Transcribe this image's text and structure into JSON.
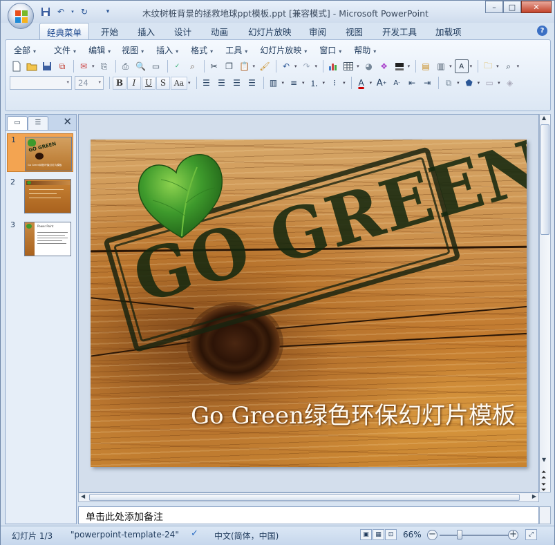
{
  "window": {
    "title": "木纹树桩背景的拯救地球ppt模板.ppt [兼容模式] - Microsoft PowerPoint",
    "minimize": "–",
    "maximize": "□",
    "close": "✕"
  },
  "ribbon_tabs": [
    "经典菜单",
    "开始",
    "插入",
    "设计",
    "动画",
    "幻灯片放映",
    "审阅",
    "视图",
    "开发工具",
    "加载项"
  ],
  "classic_menu": [
    "全部",
    "文件",
    "编辑",
    "视图",
    "插入",
    "格式",
    "工具",
    "幻灯片放映",
    "窗口",
    "帮助"
  ],
  "font_box": {
    "name": "",
    "size": "24"
  },
  "format_buttons": [
    "B",
    "I",
    "U",
    "S",
    "Aa"
  ],
  "slides_pane": {
    "close": "✕",
    "thumbnails": [
      {
        "num": "1",
        "caption": "Go Green绿色环保幻灯片模板"
      },
      {
        "num": "2",
        "caption": ""
      },
      {
        "num": "3",
        "caption": "Power Point"
      }
    ]
  },
  "slide": {
    "stamp_text": "GO GREEN",
    "title": "Go Green绿色环保幻灯片模板"
  },
  "notes": {
    "placeholder": "单击此处添加备注"
  },
  "status": {
    "slide_counter": "幻灯片 1/3",
    "theme": "\"powerpoint-template-24\"",
    "language": "中文(简体，中国)",
    "zoom": "66%",
    "zoom_minus": "−",
    "zoom_plus": "+"
  },
  "colors": {
    "selected_thumb": "#f3a451",
    "leaf_green": "#3e9a2c",
    "stamp_dark": "#14280f"
  }
}
